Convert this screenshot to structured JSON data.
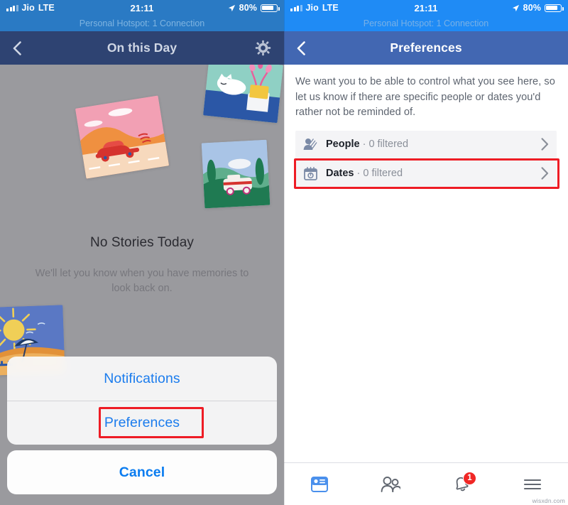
{
  "status_bar": {
    "carrier": "Jio",
    "network": "LTE",
    "time": "21:11",
    "battery_percent": "80%",
    "hotspot_text": "Personal Hotspot: 1 Connection",
    "location_icon": "location-arrow-icon",
    "signal_icon": "signal-bars-icon",
    "battery_icon": "battery-icon",
    "background_color": "#1f8bf5"
  },
  "left_screen": {
    "nav": {
      "back_icon": "chevron-left-icon",
      "title": "On this Day",
      "settings_icon": "gear-icon",
      "background_color": "#2e4372"
    },
    "empty_state": {
      "title": "No Stories Today",
      "subtitle": "We'll let you know when you have memories to look back on."
    },
    "action_sheet": {
      "options": [
        {
          "label": "Notifications",
          "name": "notifications",
          "highlighted": false
        },
        {
          "label": "Preferences",
          "name": "preferences",
          "highlighted": true
        }
      ],
      "cancel_label": "Cancel",
      "highlight_color": "#ee1c25",
      "action_color": "#1b7ced"
    }
  },
  "right_screen": {
    "nav": {
      "back_icon": "chevron-left-icon",
      "title": "Preferences",
      "background_color": "#4267b2"
    },
    "intro_text": "We want you to be able to control what you see here, so let us know if there are specific people or dates you'd rather not be reminded of.",
    "rows": [
      {
        "label": "People",
        "separator": " · ",
        "detail": "0 filtered",
        "icon": "people-filter-icon",
        "chevron": "chevron-right-icon",
        "highlighted": false
      },
      {
        "label": "Dates",
        "separator": " · ",
        "detail": "0 filtered",
        "icon": "calendar-filter-icon",
        "chevron": "chevron-right-icon",
        "highlighted": true
      }
    ],
    "tab_bar": {
      "tabs": [
        {
          "name": "news-feed",
          "icon": "news-feed-icon",
          "active": true,
          "badge": ""
        },
        {
          "name": "friends",
          "icon": "friends-icon",
          "active": false,
          "badge": ""
        },
        {
          "name": "notifications",
          "icon": "bell-icon",
          "active": false,
          "badge": "1"
        },
        {
          "name": "menu",
          "icon": "hamburger-menu-icon",
          "active": false,
          "badge": ""
        }
      ],
      "active_color": "#4a90ec",
      "inactive_color": "#616770",
      "badge_color": "#f02725"
    }
  },
  "watermark": "wisxdn.com"
}
